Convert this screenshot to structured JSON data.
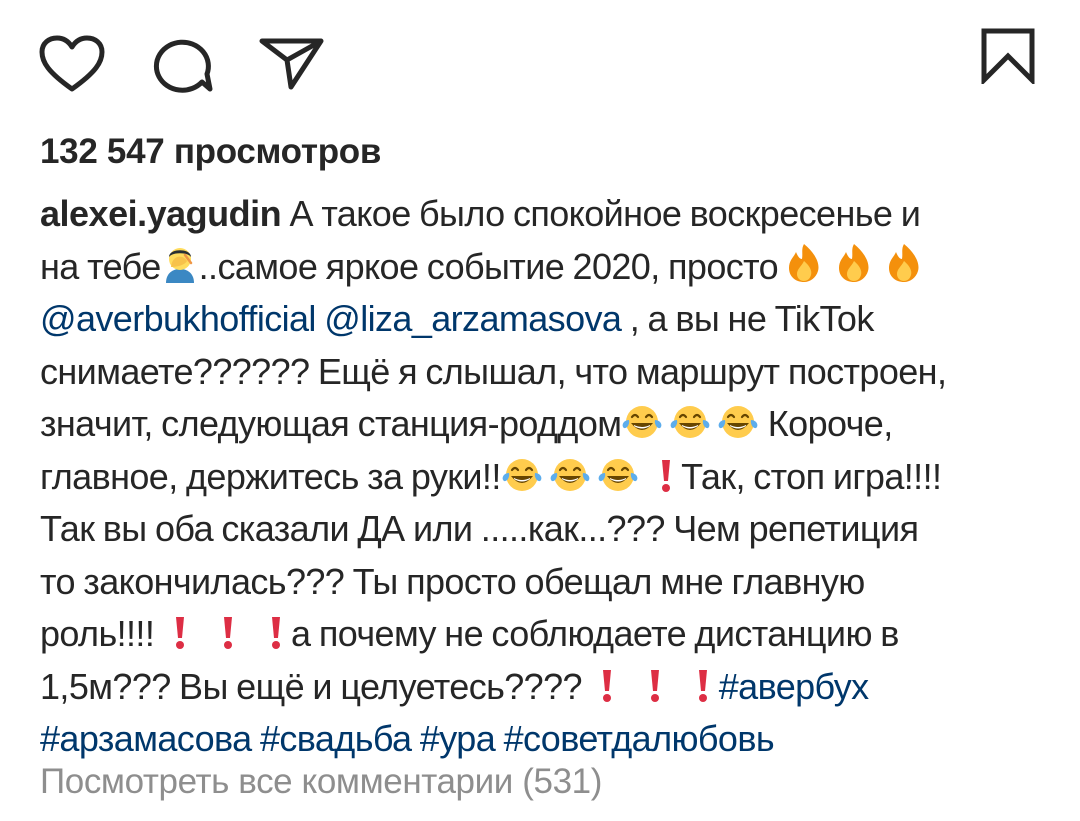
{
  "icons": {
    "like": "heart-outline-icon",
    "comment": "comment-bubble-icon",
    "share": "paper-plane-icon",
    "save": "bookmark-outline-icon"
  },
  "colors": {
    "text": "#262626",
    "link": "#00376b",
    "muted": "#8e8e8e",
    "fire_outer": "#f4900c",
    "fire_inner": "#ffcc4d",
    "exclamation": "#dd2e44",
    "laugh_face": "#ffcc4d",
    "tears": "#5dadec"
  },
  "post": {
    "views": "132 547 просмотров",
    "username": "alexei.yagudin",
    "caption": {
      "line1": " А такое было спокойное воскресенье и",
      "seg2a": "на тебе",
      "seg2b": "..самое яркое событие 2020, просто ",
      "mention1": "@averbukhofficial",
      "mention2": "@liza_arzamasova",
      "seg3": " , а вы не TikTok",
      "seg4": "снимаете?????? Ещё я слышал, что маршрут построен,",
      "seg5a": "значит, следующая станция-роддом",
      "seg5b": " Короче,",
      "seg6a": "главное, держитесь за руки!!",
      "seg6b": " Так, стоп игра!!!!",
      "seg7": "Так вы оба сказали ДА или .....как...??? Чем репетиция",
      "seg8": "то закончилась??? Ты просто обещал мне главную",
      "seg9a": "роль!!!! ",
      "seg9b": " а почему не соблюдаете дистанцию в",
      "seg10a": "1,5м??? Вы ещё и целуетесь???? ",
      "tags": [
        "#авербух",
        "#арзамасова",
        "#свадьба",
        "#ура",
        "#советдалюбовь"
      ]
    },
    "emoji": {
      "facepalm": "person-facepalming-emoji",
      "fire": "fire-emoji",
      "laugh": "face-with-tears-of-joy-emoji",
      "exclamation": "red-exclamation-mark-emoji"
    },
    "view_comments": "Посмотреть все комментарии (531)"
  }
}
